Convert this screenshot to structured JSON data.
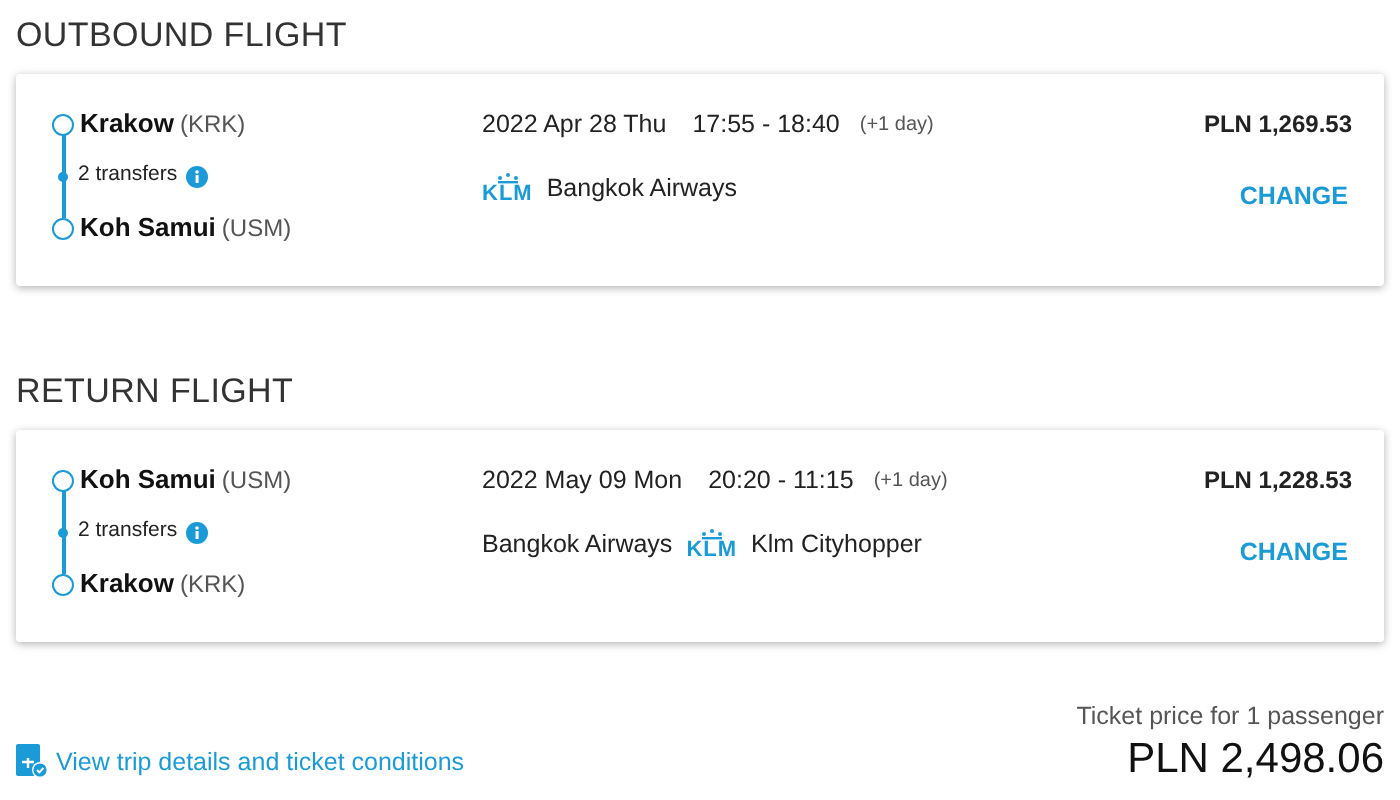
{
  "flights": [
    {
      "title": "OUTBOUND FLIGHT",
      "from": {
        "city": "Krakow",
        "code": "(KRK)"
      },
      "transfers": "2 transfers",
      "to": {
        "city": "Koh Samui",
        "code": "(USM)"
      },
      "date": "2022 Apr 28 Thu",
      "time": "17:55 - 18:40",
      "day_offset": "(+1 day)",
      "carriers": [
        {
          "kind": "logo",
          "text": "KLM"
        },
        {
          "kind": "name",
          "text": "Bangkok Airways"
        }
      ],
      "price": "PLN 1,269.53",
      "action": "CHANGE"
    },
    {
      "title": "RETURN FLIGHT",
      "from": {
        "city": "Koh Samui",
        "code": "(USM)"
      },
      "transfers": "2 transfers",
      "to": {
        "city": "Krakow",
        "code": "(KRK)"
      },
      "date": "2022 May 09 Mon",
      "time": "20:20 - 11:15",
      "day_offset": "(+1 day)",
      "carriers": [
        {
          "kind": "name",
          "text": "Bangkok Airways"
        },
        {
          "kind": "logo",
          "text": "KLM"
        },
        {
          "kind": "name",
          "text": "Klm Cityhopper"
        }
      ],
      "price": "PLN 1,228.53",
      "action": "CHANGE"
    }
  ],
  "footer": {
    "link": "View trip details and ticket conditions",
    "price_label": "Ticket price for 1 passenger",
    "total": "PLN 2,498.06"
  }
}
